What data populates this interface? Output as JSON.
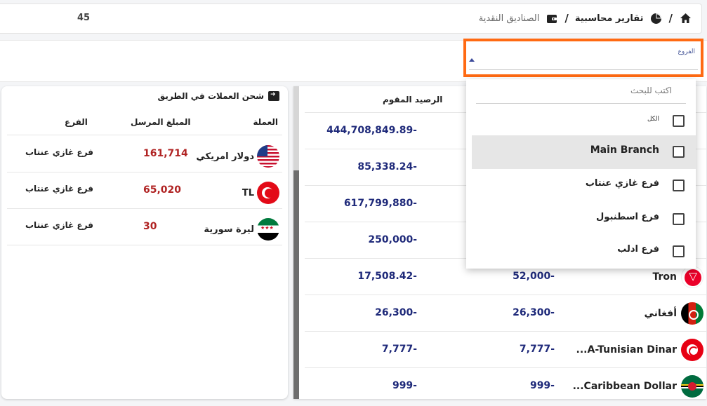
{
  "breadcrumb": {
    "count": "45",
    "items": [
      "تقارير محاسبية",
      "الصناديق النقدية"
    ],
    "separator": "/"
  },
  "filter": {
    "label": "الفروع"
  },
  "dropdown": {
    "search_placeholder": "اكتب للبحث",
    "options": [
      {
        "label": "الكل"
      },
      {
        "label": "Main Branch"
      },
      {
        "label": "فرع غازي عنتاب"
      },
      {
        "label": "فرع اسطنبول"
      },
      {
        "label": "فرع ادلب"
      }
    ]
  },
  "transit_card": {
    "title": "شحن العملات في الطريق",
    "columns": [
      "العملة",
      "المبلغ المرسل",
      "الفرع"
    ],
    "rows": [
      {
        "currency": "دولار امريكي",
        "flag": "us-flag",
        "amount": "161,714",
        "branch": "فرع غازي عنتاب"
      },
      {
        "currency": "TL",
        "flag": "tr-flag",
        "amount": "65,020",
        "branch": "فرع غازي عنتاب"
      },
      {
        "currency": "ليرة سورية",
        "flag": "sy-flag",
        "amount": "30",
        "branch": "فرع غازي عنتاب"
      }
    ]
  },
  "balance_table": {
    "column_valued_balance": "الرصيد المقوم",
    "rows": [
      {
        "valued": "444,708,849.89-",
        "balance": "",
        "currency": ""
      },
      {
        "valued": "85,338.24-",
        "balance": "",
        "currency": ""
      },
      {
        "valued": "617,799,880-",
        "balance": "",
        "currency": ""
      },
      {
        "valued": "250,000-",
        "balance": "",
        "currency": ""
      },
      {
        "valued": "17,508.42-",
        "balance": "52,000-",
        "currency": "Tron",
        "flag": "tron-logo"
      },
      {
        "valued": "26,300-",
        "balance": "26,300-",
        "currency": "أفغاني",
        "flag": "af-flag"
      },
      {
        "valued": "7,777-",
        "balance": "7,777-",
        "currency": "...A-Tunisian Dinar",
        "flag": "tn-flag"
      },
      {
        "valued": "999-",
        "balance": "999-",
        "currency": "...Caribbean Dollar",
        "flag": "dm-flag"
      }
    ]
  },
  "colors": {
    "accent_border": "#ff6a13",
    "balance_text": "#1f2a7a",
    "amount_text": "#b02323"
  }
}
